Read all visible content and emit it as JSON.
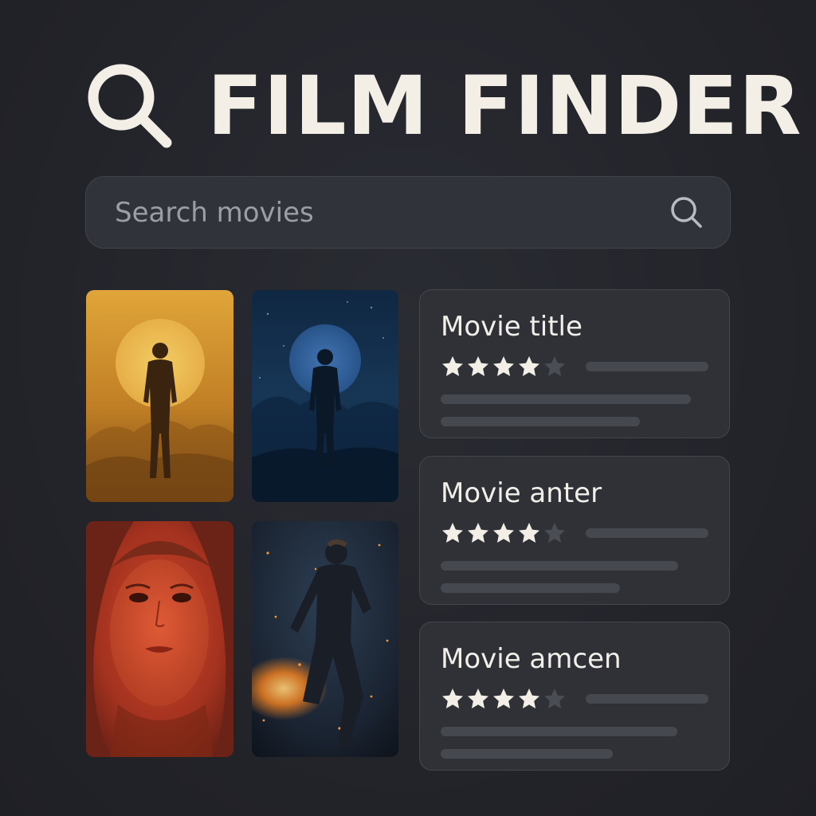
{
  "app": {
    "title": "FILM FINDER",
    "logo_icon": "search-icon",
    "accent_color": "#f3efe6",
    "background_color": "#24262c"
  },
  "search": {
    "placeholder": "Search movies",
    "value": "",
    "button_icon": "search-icon"
  },
  "posters": [
    {
      "name": "poster-silhouette-sun",
      "palette": "amber"
    },
    {
      "name": "poster-silhouette-moon",
      "palette": "blue"
    },
    {
      "name": "poster-woman-portrait",
      "palette": "red"
    },
    {
      "name": "poster-man-running",
      "palette": "dark-fire"
    }
  ],
  "results": [
    {
      "title": "Movie title",
      "rating": 4,
      "max_rating": 5
    },
    {
      "title": "Movie anter",
      "rating": 4,
      "max_rating": 5
    },
    {
      "title": "Movie amcen",
      "rating": 4,
      "max_rating": 5
    }
  ]
}
